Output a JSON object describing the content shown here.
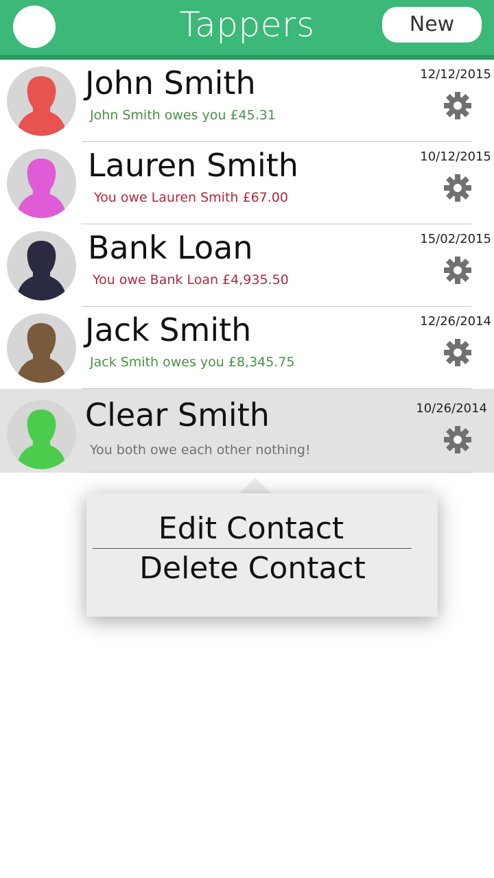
{
  "header": {
    "title": "Tappers",
    "new_label": "New"
  },
  "contacts": [
    {
      "name": "John Smith",
      "balance": "John Smith owes you £45.31",
      "balance_color": "#4a8f4a",
      "date": "12/12/2015",
      "avatar_color": "#e8524f"
    },
    {
      "name": "Lauren Smith",
      "balance": "You owe Lauren Smith £67.00",
      "balance_color": "#b0283c",
      "date": "10/12/2015",
      "avatar_color": "#e05cd6"
    },
    {
      "name": "Bank Loan",
      "balance": "You owe Bank Loan £4,935.50",
      "balance_color": "#b0283c",
      "date": "15/02/2015",
      "avatar_color": "#2a2a40"
    },
    {
      "name": "Jack Smith",
      "balance": "Jack Smith owes you £8,345.75",
      "balance_color": "#4a8f4a",
      "date": "12/26/2014",
      "avatar_color": "#7a5a3c"
    },
    {
      "name": "Clear Smith",
      "balance": "You both owe each other nothing!",
      "balance_color": "#707070",
      "date": "10/26/2014",
      "avatar_color": "#4ccc4c"
    }
  ],
  "context_menu": {
    "edit_label": "Edit Contact",
    "delete_label": "Delete Contact"
  },
  "colors": {
    "header_bg": "#3cb878",
    "selected_row_bg": "#e2e2e2",
    "gear": "#707070"
  },
  "icons": {
    "settings": "gear-icon",
    "avatar": "person-silhouette-icon"
  }
}
